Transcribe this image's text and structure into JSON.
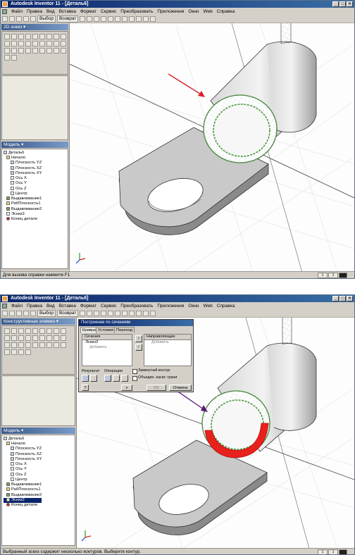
{
  "top": {
    "title": "Autodesk Inventor 11 - [Деталь6]",
    "menu": [
      "Файл",
      "Правка",
      "Вид",
      "Вставка",
      "Формат",
      "Сервис",
      "Преобразовать",
      "Приложения",
      "Окно",
      "Web",
      "Справка"
    ],
    "toolbar": {
      "select_label": "Выбор",
      "return_label": "Возврат"
    },
    "panel_header": "2D эскиз",
    "model_header": "Модель",
    "tree": [
      "Деталь6",
      "Начало",
      "Плоскость YZ",
      "Плоскость XZ",
      "Плоскость XY",
      "Ось X",
      "Ось Y",
      "Ось Z",
      "Центр",
      "Выдавливание1",
      "РабПлоскость1",
      "Выдавливание2",
      "Эскиз3",
      "Конец детали"
    ],
    "status": "Для вызова справки нажмите F1",
    "status_boxes": [
      "1",
      "1"
    ]
  },
  "bottom": {
    "title": "Autodesk Inventor 11 - [Деталь6]",
    "menu": [
      "Файл",
      "Правка",
      "Вид",
      "Вставка",
      "Формат",
      "Сервис",
      "Преобразовать",
      "Приложения",
      "Окно",
      "Web",
      "Справка"
    ],
    "toolbar": {
      "select_label": "Выбор",
      "return_label": "Возврат"
    },
    "panel_header": "Конструктивные элемен",
    "model_header": "Модель",
    "tree": [
      "Деталь6",
      "Начало",
      "Плоскость YZ",
      "Плоскость XZ",
      "Плоскость XY",
      "Ось X",
      "Ось Y",
      "Ось Z",
      "Центр",
      "Выдавливание1",
      "РабПлоскость1",
      "Выдавливание2",
      "Эскиз3",
      "Конец детали"
    ],
    "dialog": {
      "title": "Построение по сечениям",
      "tabs": [
        "Кривые",
        "Условия",
        "Переход"
      ],
      "sections_header": "Сечения",
      "sections_items": [
        "Эскиз3",
        "Добавить"
      ],
      "rails_header": "Направляющие",
      "rails_items": [
        "Добавить"
      ],
      "result_label": "Результат",
      "operation_label": "Операция",
      "closed_loop_label": "Замкнутый контур",
      "merge_faces_label": "Объедин. касат. грани",
      "ok_label": "OK",
      "cancel_label": "Отмена"
    },
    "status": "Выбранный эскиз содержит несколько контуров. Выберите контур.",
    "status_boxes": [
      "1",
      "1"
    ]
  },
  "colors": {
    "highlight_red": "#e8211c",
    "sketch_green": "#4a9a3a",
    "arrow_red": "#d9232a",
    "arrow_purple": "#5a1a7a"
  }
}
